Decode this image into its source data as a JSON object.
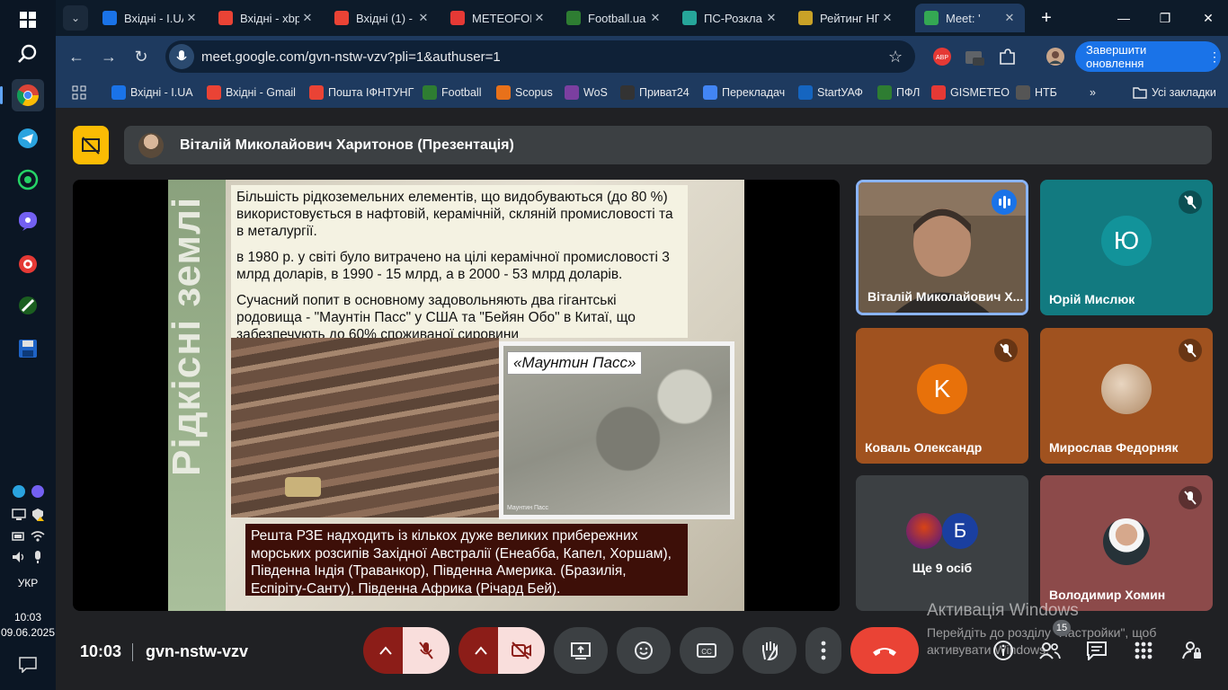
{
  "taskbar": {
    "time": "10:03",
    "date": "09.06.2025",
    "language": "УКР"
  },
  "tabs": [
    {
      "label": "Вхідні - I.UA",
      "favicon": "i-ua-icon",
      "color": "#1a73e8"
    },
    {
      "label": "Вхідні - xbp",
      "favicon": "gmail-icon",
      "color": "#ea4335"
    },
    {
      "label": "Вхідні (1) -",
      "favicon": "gmail-icon",
      "color": "#ea4335"
    },
    {
      "label": "METEOFOR",
      "favicon": "meteofor-icon",
      "color": "#e53935"
    },
    {
      "label": "Football.ua",
      "favicon": "football-icon",
      "color": "#2e7d32"
    },
    {
      "label": "ПС-Розкла",
      "favicon": "ps-icon",
      "color": "#26a69a"
    },
    {
      "label": "Рейтинг НП",
      "favicon": "shield-icon",
      "color": "#c9a227"
    },
    {
      "label": "Meet: '",
      "favicon": "meet-icon",
      "color": "#34a853"
    }
  ],
  "toolbar": {
    "url": "meet.google.com/gvn-nstw-vzv?pli=1&authuser=1",
    "update_label": "Завершити оновлення"
  },
  "bookmarks": [
    {
      "label": "Вхідні - I.UA",
      "icon": "i-ua-icon",
      "color": "#1a73e8"
    },
    {
      "label": "Вхідні - Gmail",
      "icon": "gmail-icon",
      "color": "#ea4335"
    },
    {
      "label": "Пошта ІФНТУНГ",
      "icon": "gmail-icon",
      "color": "#ea4335"
    },
    {
      "label": "Football",
      "icon": "football-icon",
      "color": "#2e7d32"
    },
    {
      "label": "Scopus",
      "icon": "scopus-icon",
      "color": "#e8711a"
    },
    {
      "label": "WoS",
      "icon": "wos-icon",
      "color": "#7b3fa0"
    },
    {
      "label": "Приват24",
      "icon": "privat-icon",
      "color": "#333333"
    },
    {
      "label": "Перекладач",
      "icon": "translate-icon",
      "color": "#4285f4"
    },
    {
      "label": "StartУАФ",
      "icon": "start-uaf-icon",
      "color": "#1565c0"
    },
    {
      "label": "ПФЛ",
      "icon": "pfl-icon",
      "color": "#2e7d32"
    },
    {
      "label": "GISMETEO",
      "icon": "gismeteo-icon",
      "color": "#e53935"
    },
    {
      "label": "НТБ",
      "icon": "ntb-icon",
      "color": "#555555"
    }
  ],
  "all_bookmarks_label": "Усі закладки",
  "meet": {
    "presenter_label": "Віталій Миколайович Харитонов (Презентація)",
    "meeting_code": "gvn-nstw-vzv",
    "time": "10:03",
    "participants_count": "15"
  },
  "slide": {
    "side_title": "Рідкісні землі",
    "paragraph1": "Більшість рідкоземельних елементів, що видобуваються (до 80 %) використовується в нафтовій, керамічній, скляній промисловості та в металургії.",
    "paragraph2": "в 1980 р. у світі було витрачено на цілі керамічної промисловості 3 млрд доларів, в 1990 - 15 млрд, а в 2000 - 53 млрд доларів.",
    "paragraph3": "Сучасний попит в основному задовольняють два гігантські родовища - \"Маунтін Пасс\" у США та \"Бейян Обо\" в Китаї, що забезпечують до 60% споживаної сировини",
    "photo_label": "«Маунтин Пасс»",
    "photo_caption": "Маунтин Пасс",
    "bottom_text": "Решта РЗЕ надходить із кількох дуже великих прибережних морських розсипів Західної Австралії (Енеабба, Капел, Хоршам), Південна Індія (Траванкор), Південна Америка. (Бразилія, Еспіріту-Санту), Південна Африка (Річард Бей)."
  },
  "tiles": [
    {
      "name": "Віталій Миколайович Х...",
      "type": "video"
    },
    {
      "name": "Юрій Мислюк",
      "initial": "Ю",
      "bg": "#127a80",
      "avatar": "#12939a"
    },
    {
      "name": "Коваль Олександр",
      "initial": "K",
      "bg": "#a0521f",
      "avatar": "#e8710a"
    },
    {
      "name": "Мирослав Федорняк",
      "type": "photo",
      "bg": "#a0521f"
    },
    {
      "name": "Ще 9 осіб",
      "initial": "Б",
      "bg": "#3c4043"
    },
    {
      "name": "Володимир Хомин",
      "type": "photo",
      "bg": "#8c4a4a"
    }
  ],
  "activation": {
    "title": "Активація Windows",
    "subtitle": "Перейдіть до розділу \"Настройки\", щоб активувати Windows."
  }
}
